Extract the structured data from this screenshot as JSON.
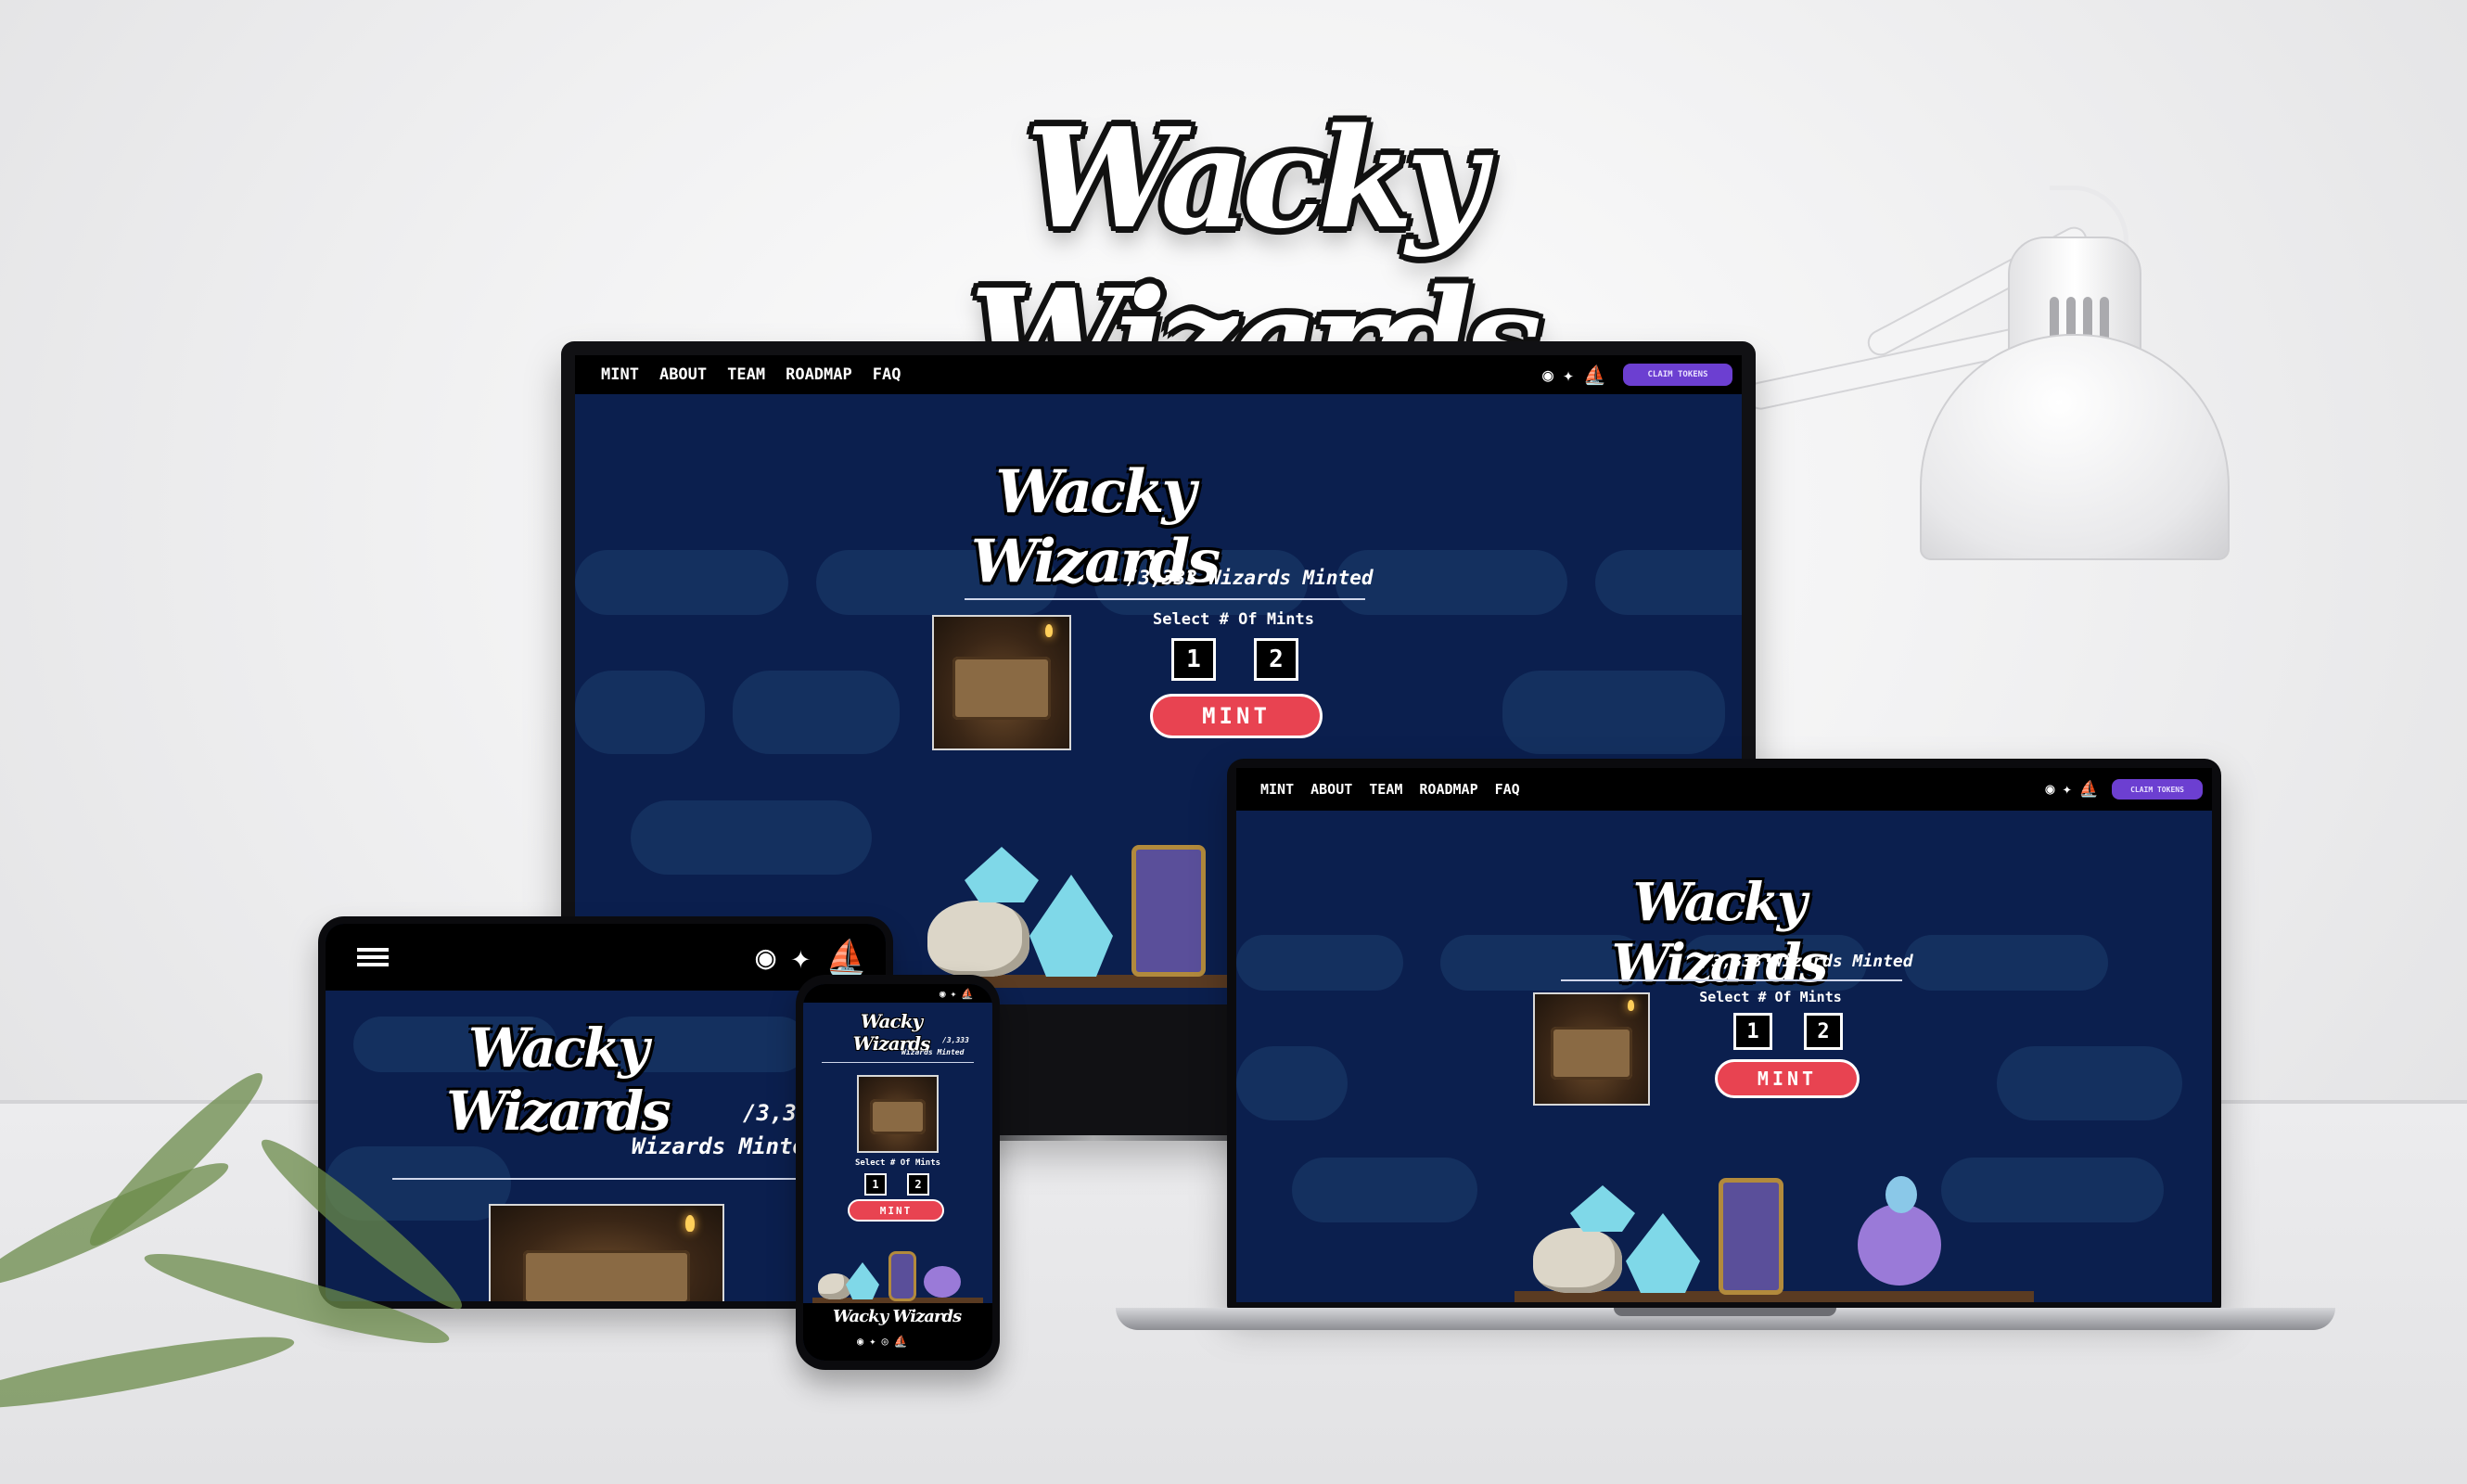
{
  "brand": {
    "title": "Wacky Wizards"
  },
  "nav": {
    "links": [
      "MINT",
      "ABOUT",
      "TEAM",
      "ROADMAP",
      "FAQ"
    ],
    "claim_label": "CLAIM TOKENS"
  },
  "socials": {
    "discord_icon": "discord-icon",
    "twitter_icon": "twitter-icon",
    "opensea_icon": "opensea-icon",
    "instagram_icon": "instagram-icon"
  },
  "mint": {
    "minted_text": "/3,333 Wizards Minted",
    "tablet_minted_line1": "/3,33",
    "tablet_minted_line2": "Wizards Minte",
    "phone_minted_line1": "/3,333",
    "phone_minted_line2": "Wizards Minted",
    "select_label": "Select # Of Mints",
    "options": [
      "1",
      "2"
    ],
    "button_label": "MINT"
  },
  "colors": {
    "background": "#0b1f4e",
    "nav": "#000000",
    "mint_button": "#e84351",
    "claim_button": "#6c3fd1"
  }
}
